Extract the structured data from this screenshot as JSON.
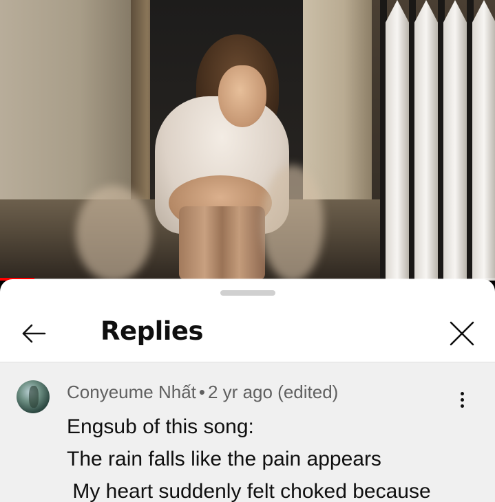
{
  "video": {
    "progress_fraction": 0.07,
    "accent_color": "#ff0000"
  },
  "replies_panel": {
    "title": "Replies",
    "back_icon": "arrow-left-icon",
    "close_icon": "close-icon",
    "comment": {
      "author": "Conyeume Nhất",
      "separator": "•",
      "time": "2 yr ago (edited)",
      "more_icon": "more-vertical-icon",
      "lines": [
        "Engsub of this song:",
        "The rain falls like the pain appears",
        " My heart suddenly felt choked because"
      ]
    }
  }
}
